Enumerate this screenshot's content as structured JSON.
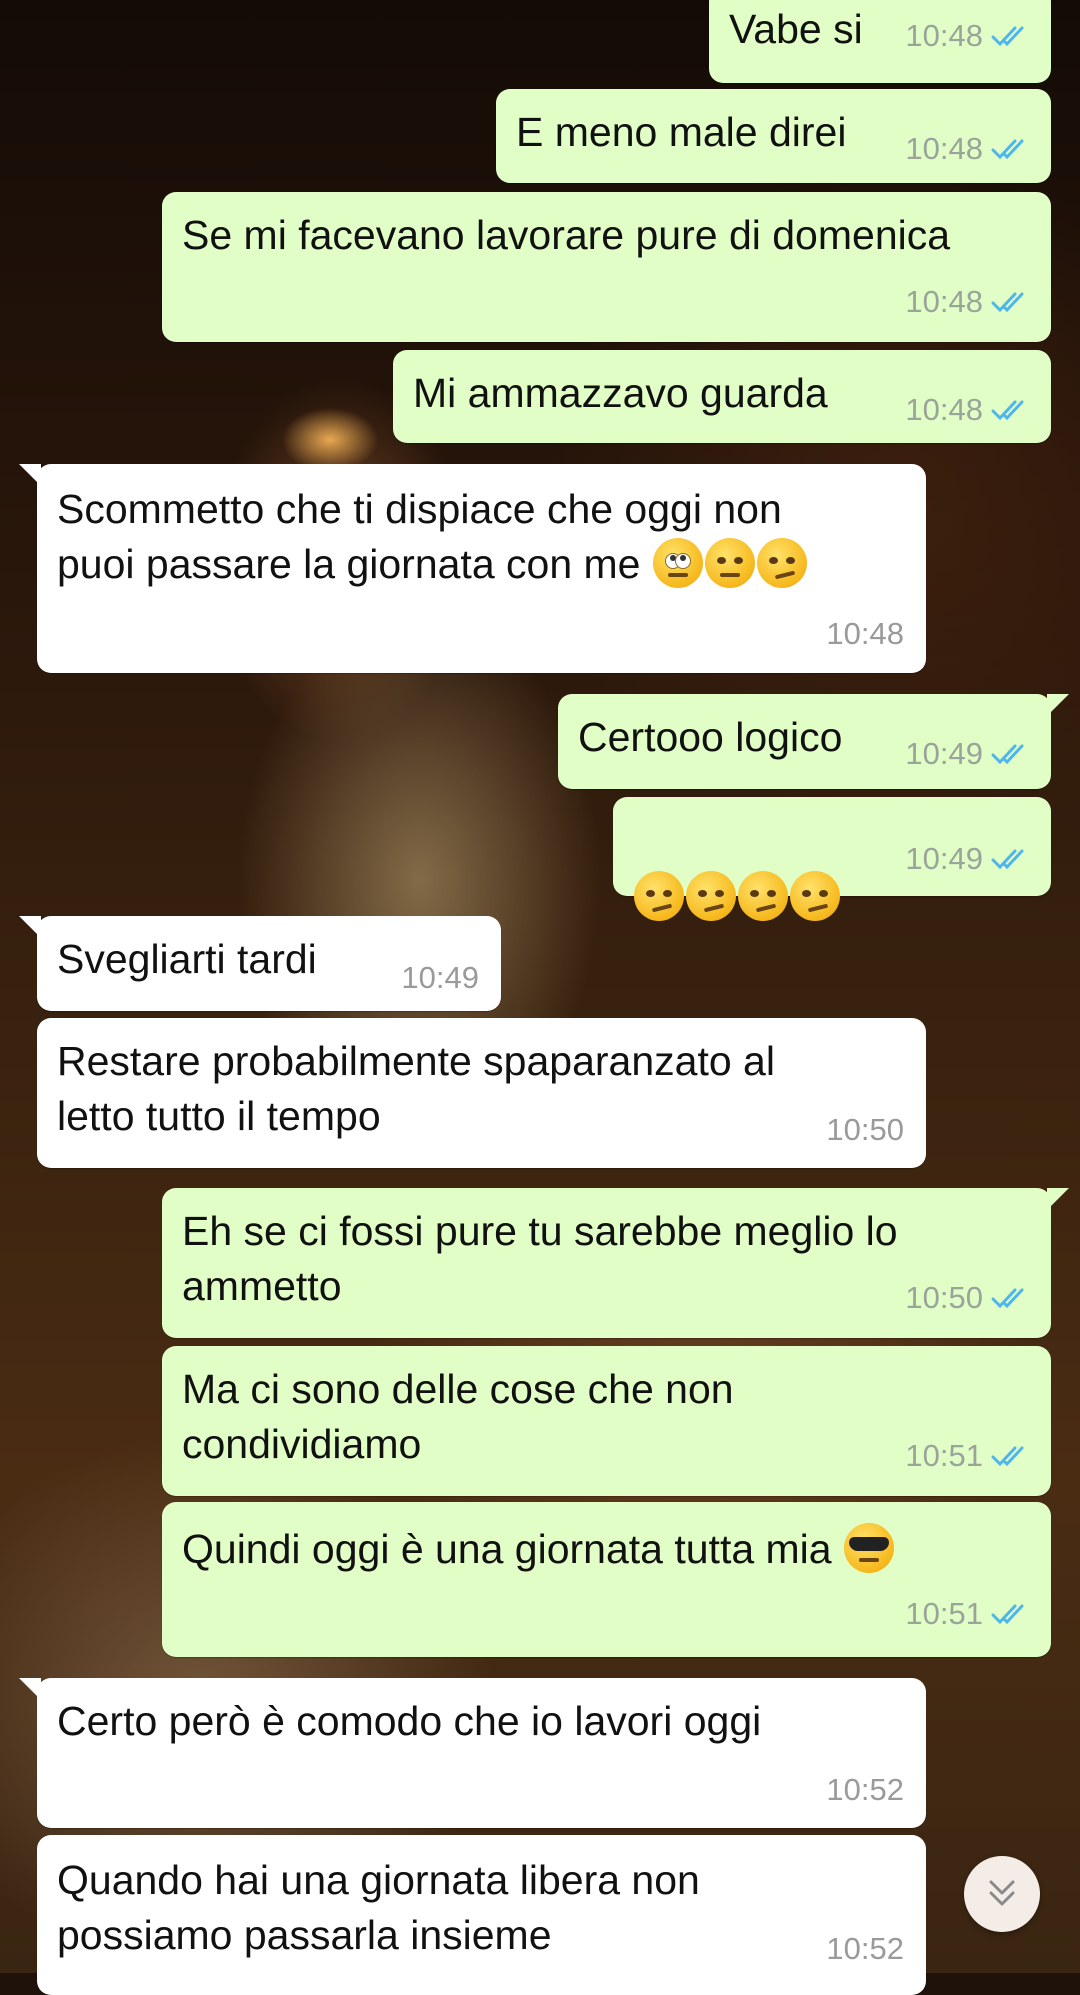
{
  "chat": {
    "messages": [
      {
        "dir": "out",
        "text": "Vabe si",
        "time": "10:48",
        "status": "read"
      },
      {
        "dir": "out",
        "text": "E meno male direi",
        "time": "10:48",
        "status": "read"
      },
      {
        "dir": "out",
        "text": "Se mi facevano lavorare pure di domenica",
        "time": "10:48",
        "status": "read"
      },
      {
        "dir": "out",
        "text": "Mi ammazzavo guarda",
        "time": "10:48",
        "status": "read"
      },
      {
        "dir": "in",
        "text": "Scommetto che ti dispiace che oggi non\npuoi passare la giornata con me",
        "emojis": [
          "face-with-rolling-eyes",
          "face-with-raised-eyebrow",
          "unamused-face"
        ],
        "time": "10:48"
      },
      {
        "dir": "out",
        "text": "Certooo logico",
        "time": "10:49",
        "status": "read"
      },
      {
        "dir": "out",
        "text": "",
        "emojis": [
          "smirking-face",
          "smirking-face",
          "smirking-face",
          "smirking-face"
        ],
        "time": "10:49",
        "status": "read"
      },
      {
        "dir": "in",
        "text": "Svegliarti tardi",
        "time": "10:49"
      },
      {
        "dir": "in",
        "text": "Restare probabilmente spaparanzato al\nletto tutto il tempo",
        "time": "10:50"
      },
      {
        "dir": "out",
        "text": "Eh se ci fossi pure tu sarebbe meglio lo\nammetto",
        "time": "10:50",
        "status": "read"
      },
      {
        "dir": "out",
        "text": "Ma ci sono delle cose che non\ncondividiamo",
        "time": "10:51",
        "status": "read"
      },
      {
        "dir": "out",
        "text": "Quindi oggi è una giornata tutta mia",
        "emojis": [
          "smiling-face-with-sunglasses"
        ],
        "time": "10:51",
        "status": "read"
      },
      {
        "dir": "in",
        "text": "Certo però è comodo che io lavori oggi",
        "time": "10:52"
      },
      {
        "dir": "in",
        "text": "Quando hai una giornata libera non\npossiamo passarla insieme",
        "time": "10:52"
      }
    ]
  },
  "icons": {
    "read_receipt": "double-check-icon",
    "scroll_down": "double-chevron-down-icon"
  },
  "colors": {
    "outgoing_bubble": "#e1fec6",
    "incoming_bubble": "#ffffff",
    "read_tick": "#4fb6ec",
    "timestamp": "#9aa49a"
  }
}
